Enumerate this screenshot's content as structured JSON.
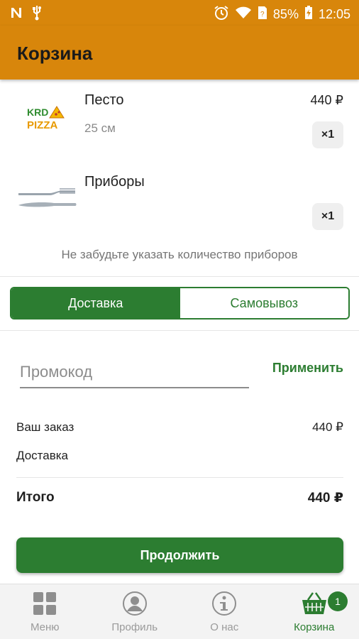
{
  "status_bar": {
    "battery": "85%",
    "time": "12:05"
  },
  "app_bar": {
    "title": "Корзина"
  },
  "cart": {
    "items": [
      {
        "name": "Песто",
        "size": "25 см",
        "price": "440 ₽",
        "qty": "×1",
        "logo_text_top": "KRD",
        "logo_text_bottom": "PIZZA"
      },
      {
        "name": "Приборы",
        "size": "",
        "price": "",
        "qty": "×1"
      }
    ],
    "reminder": "Не забудьте указать количество приборов"
  },
  "delivery_toggle": {
    "options": [
      "Доставка",
      "Самовывоз"
    ],
    "selected": "Доставка"
  },
  "promo": {
    "placeholder": "Промокод",
    "value": "",
    "apply_label": "Применить"
  },
  "summary": {
    "order_label": "Ваш заказ",
    "order_value": "440 ₽",
    "delivery_label": "Доставка",
    "delivery_value": "",
    "total_label": "Итого",
    "total_value": "440 ₽"
  },
  "continue_label": "Продолжить",
  "bottom_nav": {
    "items": [
      {
        "label": "Меню",
        "icon": "menu-grid-icon"
      },
      {
        "label": "Профиль",
        "icon": "profile-icon"
      },
      {
        "label": "О нас",
        "icon": "info-icon"
      },
      {
        "label": "Корзина",
        "icon": "basket-icon",
        "badge": "1"
      }
    ],
    "active": "Корзина"
  },
  "colors": {
    "primary": "#d8860b",
    "accent": "#2c7d31"
  }
}
